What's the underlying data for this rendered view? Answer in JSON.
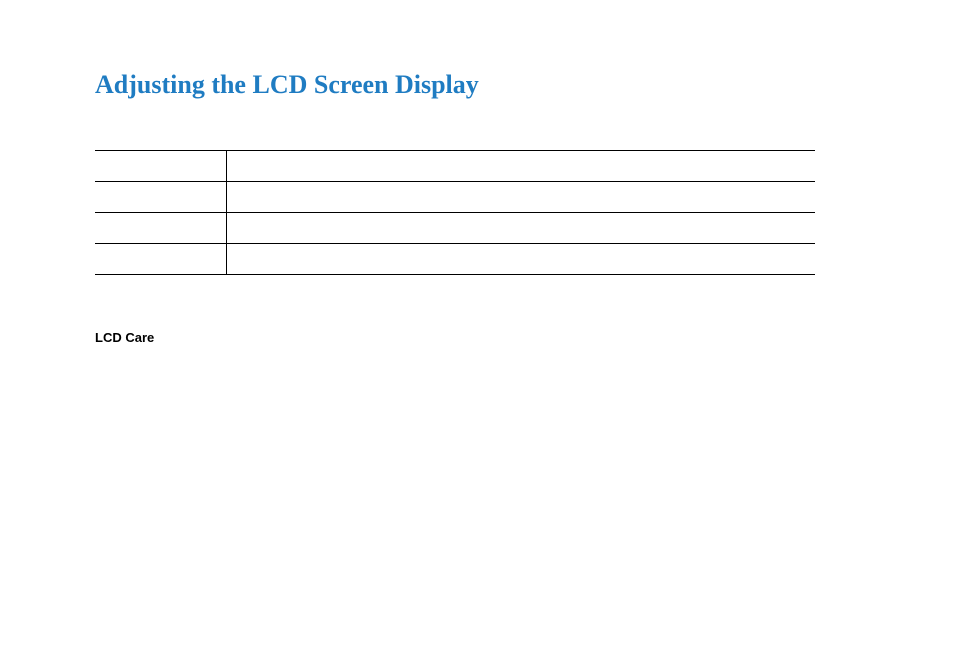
{
  "title": "Adjusting the LCD Screen Display",
  "table": {
    "rows": [
      {
        "left": "",
        "right": ""
      },
      {
        "left": "",
        "right": ""
      },
      {
        "left": "",
        "right": ""
      },
      {
        "left": "",
        "right": ""
      }
    ]
  },
  "subheading": "LCD Care"
}
